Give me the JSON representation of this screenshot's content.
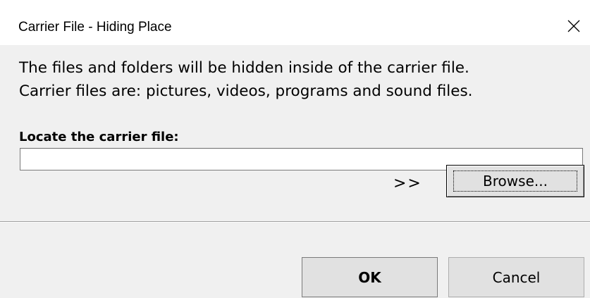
{
  "window": {
    "title": "Carrier File - Hiding Place",
    "close_icon": "close-icon"
  },
  "description": {
    "line1": "The files and folders will be hidden inside of the carrier file.",
    "line2": "Carrier files are: pictures, videos, programs and sound files."
  },
  "carrier": {
    "label": "Locate the carrier file:",
    "path_value": "",
    "arrows": ">>",
    "browse_label": "Browse..."
  },
  "footer": {
    "ok_label": "OK",
    "cancel_label": "Cancel"
  }
}
